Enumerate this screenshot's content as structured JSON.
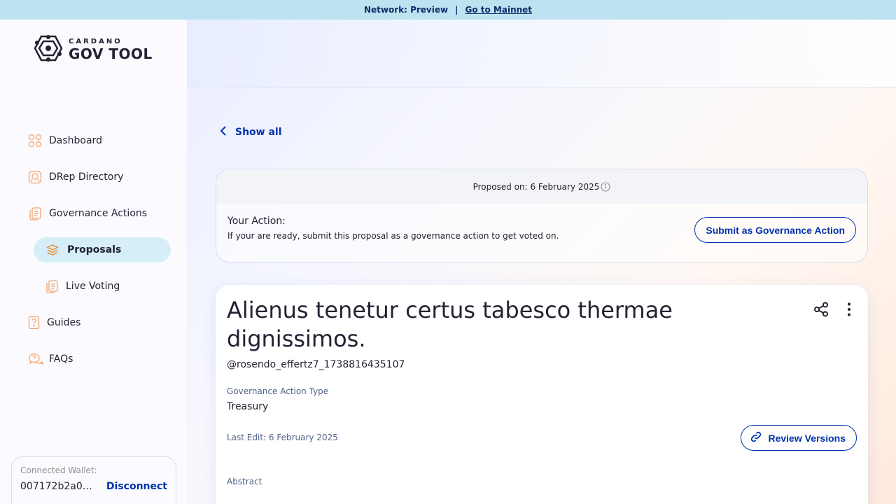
{
  "network_bar": {
    "label": "Network: Preview",
    "separator": "|",
    "link": "Go to Mainnet"
  },
  "logo": {
    "small": "CARDANO",
    "big": "GOV TOOL"
  },
  "sidebar": {
    "items": [
      {
        "label": "Dashboard",
        "icon": "grid-icon"
      },
      {
        "label": "DRep Directory",
        "icon": "drep-icon"
      },
      {
        "label": "Governance Actions",
        "icon": "documents-icon"
      },
      {
        "label": "Proposals",
        "icon": "layers-icon",
        "active": true
      },
      {
        "label": "Live Voting",
        "icon": "documents-icon"
      },
      {
        "label": "Guides",
        "icon": "guide-icon"
      },
      {
        "label": "FAQs",
        "icon": "chat-icon"
      }
    ],
    "wallet": {
      "label": "Connected Wallet:",
      "address": "007172b2a0a5...",
      "disconnect": "Disconnect"
    }
  },
  "main": {
    "show_all": "Show all",
    "proposed": {
      "date_text": "Proposed on: 6 February 2025",
      "your_action_title": "Your Action:",
      "your_action_desc": "If your are ready, submit this proposal as a governance action to get voted on.",
      "submit_button": "Submit as Governance Action"
    },
    "detail": {
      "title": "Alienus tenetur certus tabesco thermae dignissimos.",
      "username": "@rosendo_effertz7_1738816435107",
      "type_label": "Governance Action Type",
      "type_value": "Treasury",
      "last_edit": "Last Edit: 6 February 2025",
      "review_button": "Review Versions",
      "abstract_label": "Abstract"
    }
  },
  "colors": {
    "accent": "#0033ad",
    "network_bar": "#bde3f0",
    "active_nav": "#d6eef7",
    "icon_orange": "#f4a56b"
  }
}
